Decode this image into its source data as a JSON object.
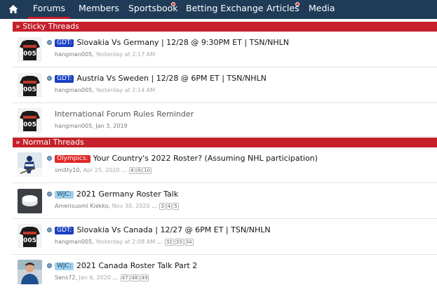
{
  "nav": {
    "home_icon": "home-icon",
    "tabs": [
      {
        "label": "Forums",
        "active": true
      },
      {
        "label": "Members"
      },
      {
        "label": "Sportsbook",
        "alert": true
      },
      {
        "label": "Betting Exchange"
      },
      {
        "label": "Articles",
        "alert": true
      },
      {
        "label": "Media"
      }
    ]
  },
  "sticky_section": {
    "title": "» Sticky Threads"
  },
  "sticky_threads": [
    {
      "prefix": "GDT:",
      "title": "Slovakia Vs Germany | 12/28 @ 9:30PM ET | TSN/NHLN",
      "author": "hangman005",
      "date": "Yesterday at 2:17 AM"
    },
    {
      "prefix": "GDT:",
      "title": "Austria Vs Sweden | 12/28 @ 6PM ET | TSN/NHLN",
      "author": "hangman005",
      "date": "Yesterday at 2:14 AM"
    },
    {
      "prefix": "",
      "title": "International Forum Rules Reminder",
      "author": "hangman005",
      "date": "Jan 3, 2019"
    }
  ],
  "normal_section": {
    "title": "» Normal Threads"
  },
  "normal_threads": [
    {
      "prefix": "Olympics:",
      "title": "Your Country's 2022 Roster? (Assuming NHL participation)",
      "author": "smitty10",
      "date": "Apr 25, 2020",
      "pages": [
        "8",
        "9",
        "10"
      ]
    },
    {
      "prefix": "WJC:",
      "title": "2021 Germany Roster Talk",
      "author": "Amerisuomi Kiekko",
      "date": "Nov 30, 2020",
      "pages": [
        "3",
        "4",
        "5"
      ]
    },
    {
      "prefix": "GDT:",
      "title": "Slovakia Vs Canada | 12/27 @ 6PM ET | TSN/NHLN",
      "author": "hangman005",
      "date": "Yesterday at 2:08 AM",
      "pages": [
        "32",
        "33",
        "34"
      ]
    },
    {
      "prefix": "WJC:",
      "title": "2021 Canada Roster Talk Part 2",
      "author": "Sens72",
      "date": "Jan 6, 2020",
      "pages": [
        "47",
        "48",
        "49"
      ]
    }
  ],
  "separators": {
    "comma": ",",
    "ellipsis": "..."
  },
  "colors": {
    "nav_bg": "#1f3b57",
    "section_bg": "#c5202b",
    "gdt": "#1a3fc4",
    "olympics": "#e02525",
    "wjc": "#9fd1ec"
  }
}
